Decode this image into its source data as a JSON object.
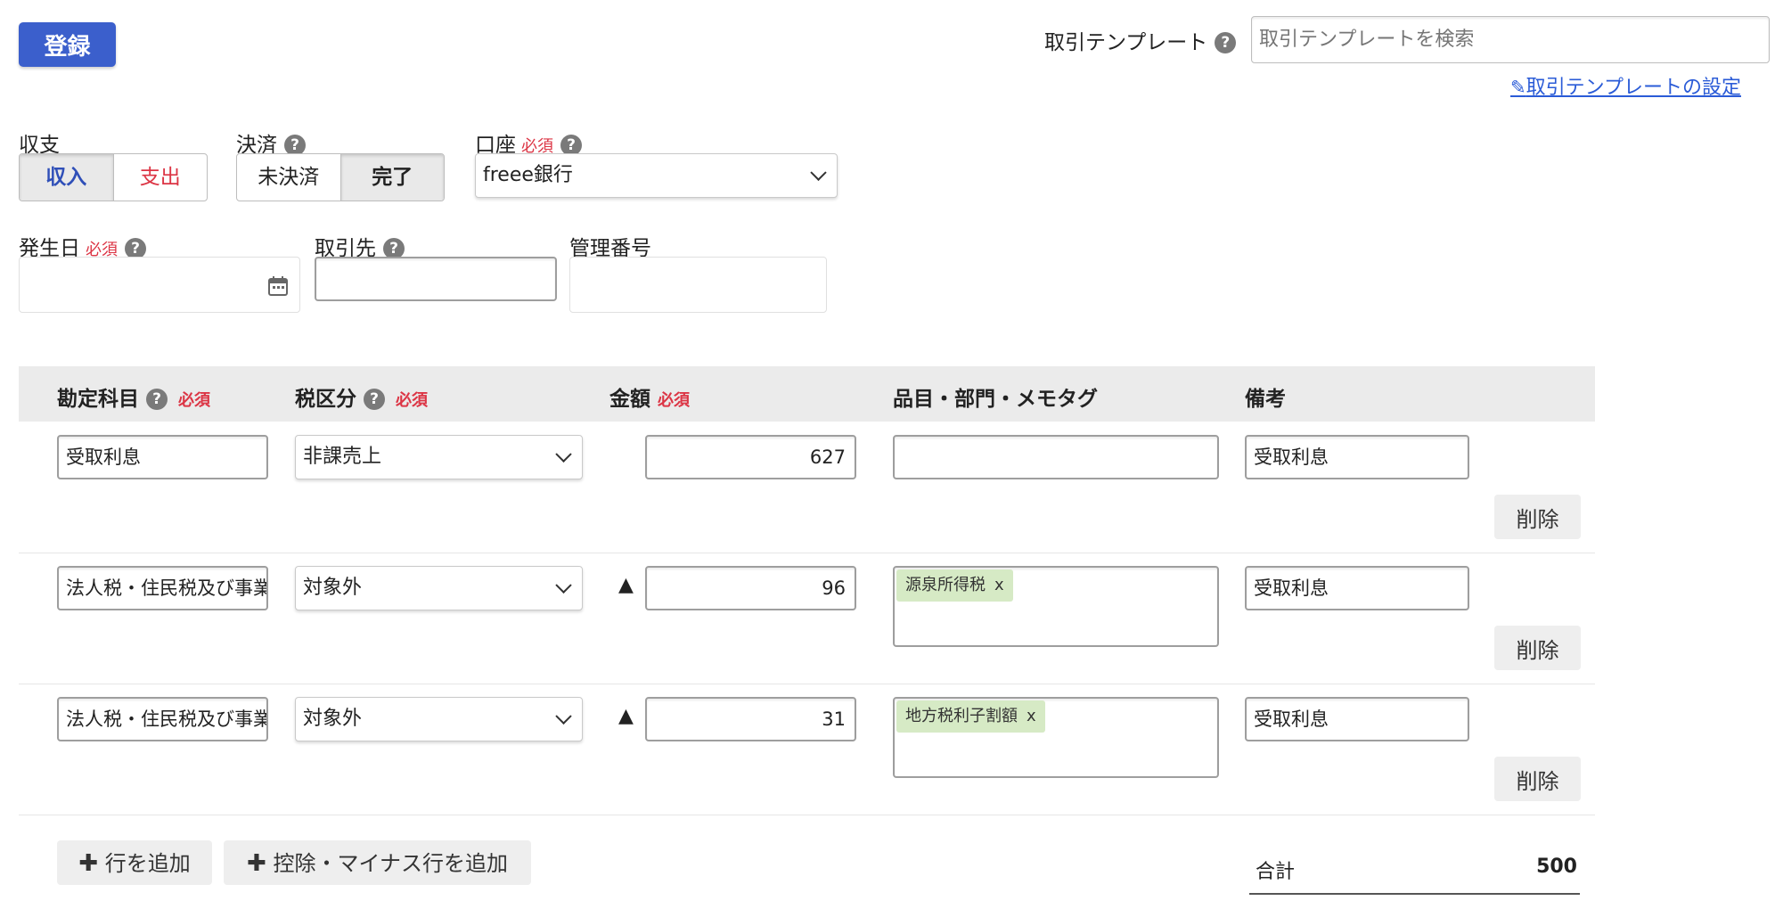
{
  "header": {
    "register_label": "登録",
    "template_label": "取引テンプレート",
    "template_placeholder": "取引テンプレートを検索",
    "template_settings_link": "取引テンプレートの設定"
  },
  "form": {
    "income_expense": {
      "label": "収支",
      "income": "収入",
      "expense": "支出"
    },
    "settlement": {
      "label": "決済",
      "unsettled": "未決済",
      "completed": "完了"
    },
    "account": {
      "label": "口座",
      "required": "必須",
      "value": "freee銀行"
    },
    "date": {
      "label": "発生日",
      "required": "必須",
      "value": ""
    },
    "partner": {
      "label": "取引先",
      "value": ""
    },
    "ref_number": {
      "label": "管理番号",
      "value": ""
    }
  },
  "table": {
    "headers": {
      "account_item": "勘定科目",
      "tax": "税区分",
      "amount": "金額",
      "tags": "品目・部門・メモタグ",
      "remarks": "備考",
      "required": "必須"
    },
    "rows": [
      {
        "account_item": "受取利息",
        "tax": "非課売上",
        "minus": "",
        "amount": "627",
        "tag": "",
        "remarks": "受取利息",
        "delete": "削除"
      },
      {
        "account_item": "法人税・住民税及び事業税",
        "tax": "対象外",
        "minus": "▲",
        "amount": "96",
        "tag": "源泉所得税",
        "tag_remove": "x",
        "remarks": "受取利息",
        "delete": "削除"
      },
      {
        "account_item": "法人税・住民税及び事業税",
        "tax": "対象外",
        "minus": "▲",
        "amount": "31",
        "tag": "地方税利子割額",
        "tag_remove": "x",
        "remarks": "受取利息",
        "delete": "削除"
      }
    ]
  },
  "footer": {
    "add_row": "行を追加",
    "add_deduction_row": "控除・マイナス行を追加",
    "total_label": "合計",
    "total_value": "500"
  },
  "colors": {
    "primary": "#3b5fcc",
    "income_text": "#2f4fb8",
    "expense_text": "#dc3545",
    "required": "#dc3545",
    "tag_bg": "#d6eac5",
    "header_bg": "#ebebeb"
  }
}
